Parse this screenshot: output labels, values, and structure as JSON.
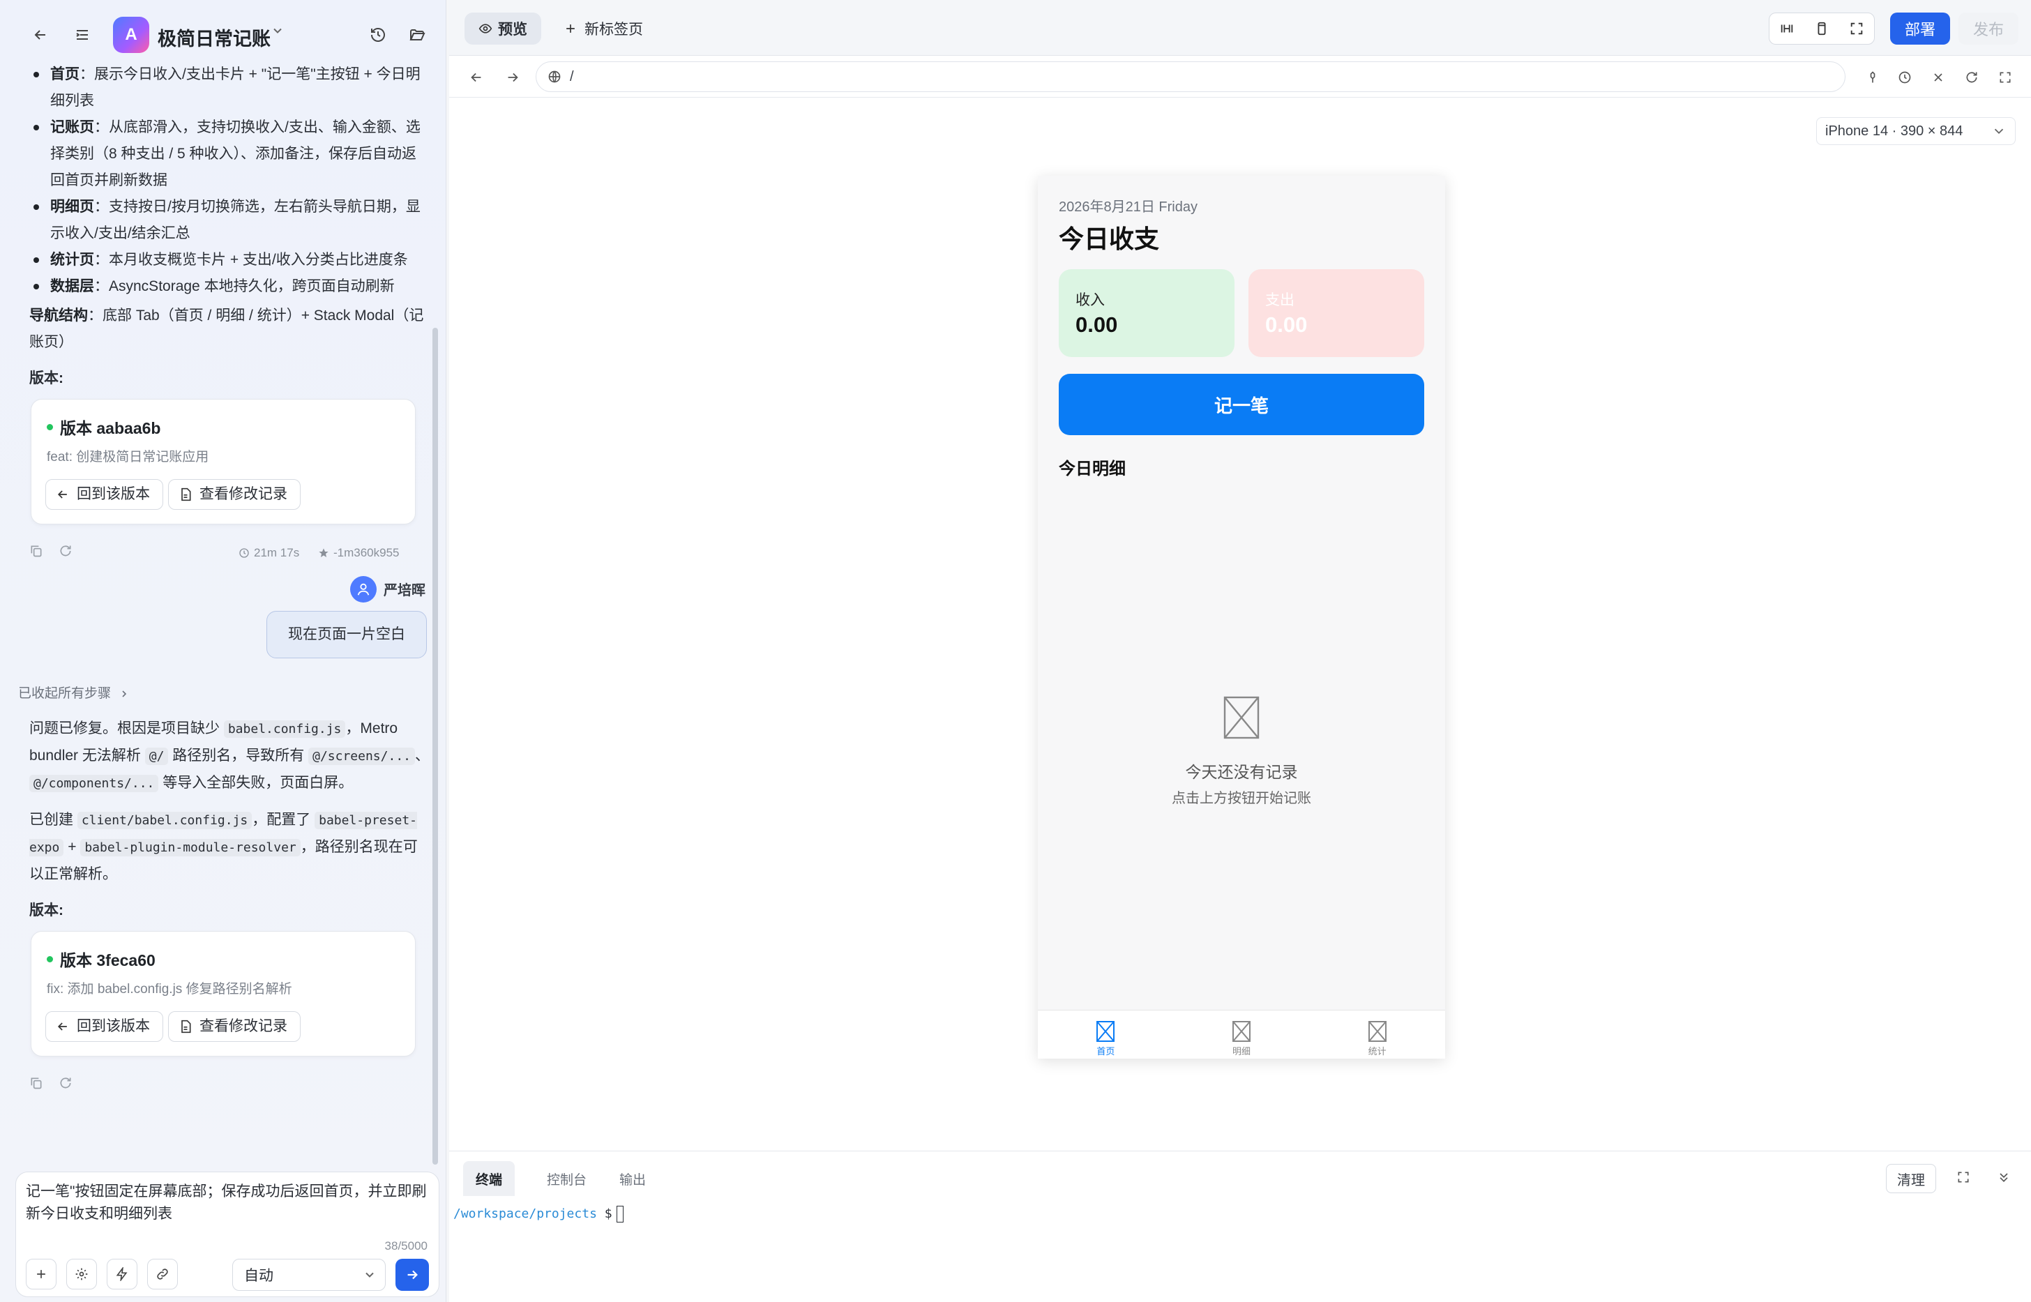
{
  "app": {
    "title": "极简日常记账",
    "logo_letter": "A"
  },
  "chat": {
    "bullets": [
      {
        "label": "首页",
        "text": "：展示今日收入/支出卡片 + \"记一笔\"主按钮 + 今日明细列表"
      },
      {
        "label": "记账页",
        "text": "：从底部滑入，支持切换收入/支出、输入金额、选择类别（8 种支出 / 5 种收入）、添加备注，保存后自动返回首页并刷新数据"
      },
      {
        "label": "明细页",
        "text": "：支持按日/按月切换筛选，左右箭头导航日期，显示收入/支出/结余汇总"
      },
      {
        "label": "统计页",
        "text": "：本月收支概览卡片 + 支出/收入分类占比进度条"
      },
      {
        "label": "数据层",
        "text": "：AsyncStorage 本地持久化，跨页面自动刷新"
      }
    ],
    "nav_label": "导航结构",
    "nav_text": "：底部 Tab（首页 / 明细 / 统计）+ Stack Modal（记账页）",
    "version_label_1": "版本:",
    "version1": {
      "title": "版本 aabaa6b",
      "desc": "feat: 创建极简日常记账应用",
      "revert_label": "回到该版本",
      "changes_label": "查看修改记录"
    },
    "meta1": {
      "duration": "21m 17s",
      "tokens": "-1m360k955"
    },
    "user": {
      "name": "严培晖",
      "message": "现在页面一片空白"
    },
    "collapsed_label": "已收起所有步骤",
    "reply": {
      "p1_a": "问题已修复。根因是项目缺少",
      "p1_code1": "babel.config.js",
      "p1_b": "，Metro bundler 无法解析",
      "p1_code2": "@/",
      "p1_c": "路径别名，导致所有",
      "p1_code3": "@/screens/...",
      "p1_d": "、",
      "p1_code4": "@/components/...",
      "p1_e": "等导入全部失败，页面白屏。",
      "p2_a": "已创建",
      "p2_code1": "client/babel.config.js",
      "p2_b": "，配置了",
      "p2_code2": "babel-preset-expo",
      "p2_c": "+",
      "p2_code3": "babel-plugin-module-resolver",
      "p2_d": "，路径别名现在可以正常解析。"
    },
    "version_label_2": "版本:",
    "version2": {
      "title": "版本 3feca60",
      "desc": "fix: 添加 babel.config.js 修复路径别名解析",
      "revert_label": "回到该版本",
      "changes_label": "查看修改记录"
    }
  },
  "composer": {
    "value": "记一笔\"按钮固定在屏幕底部；保存成功后返回首页，并立即刷新今日收支和明细列表",
    "counter": "38/5000",
    "mode": "自动"
  },
  "workspace": {
    "tab_preview": "预览",
    "tab_new": "新标签页",
    "deploy": "部署",
    "publish": "发布",
    "url": "/",
    "device": "iPhone 14 · 390 × 844"
  },
  "phone": {
    "date": "2026年8月21日 Friday",
    "title": "今日收支",
    "income_label": "收入",
    "income_value": "0.00",
    "expense_label": "支出",
    "expense_value": "0.00",
    "record_button": "记一笔",
    "section_title": "今日明细",
    "empty_title": "今天还没有记录",
    "empty_hint": "点击上方按钮开始记账",
    "tabs": [
      "首页",
      "明细",
      "统计"
    ]
  },
  "terminal": {
    "tabs": [
      "终端",
      "控制台",
      "输出"
    ],
    "clear": "清理",
    "prompt_path": "/workspace/projects",
    "prompt_symbol": "$"
  },
  "colors": {
    "accent": "#2563eb",
    "record_button": "#0a7cf5",
    "income_card": "#dcf5e3",
    "expense_card": "#fde1e1",
    "version_dot": "#22c55e"
  }
}
